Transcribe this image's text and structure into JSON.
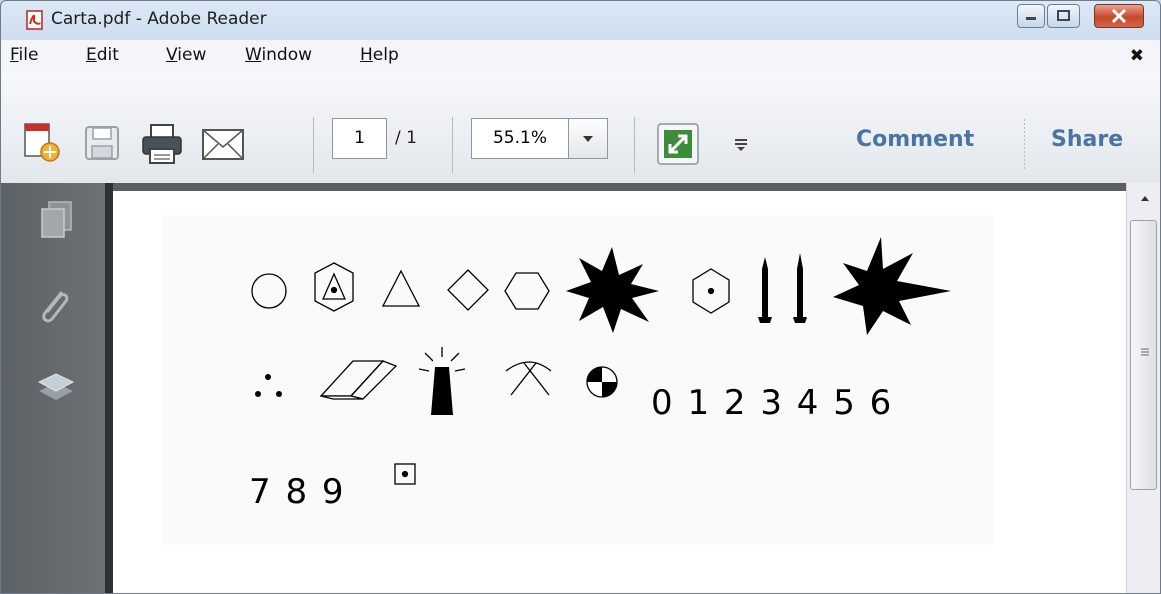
{
  "window": {
    "title": "Carta.pdf - Adobe Reader",
    "close_menu_glyph": "✖"
  },
  "menu": {
    "items": [
      "File",
      "Edit",
      "View",
      "Window",
      "Help"
    ]
  },
  "toolbar": {
    "page_current": "1",
    "page_total": "/ 1",
    "zoom": "55.1%",
    "comment_label": "Comment",
    "share_label": "Share"
  },
  "document": {
    "digits_line1": "0 1 2 3 4 5 6",
    "digits_line2": "7 8 9"
  },
  "colors": {
    "title_bg": "#c9d9ec",
    "link": "#4a75a2",
    "close_red": "#c44a2b",
    "pane": "#63686c"
  },
  "icons": [
    "pdf-app-icon",
    "minimize-icon",
    "maximize-icon",
    "close-icon",
    "create-pdf-icon",
    "save-icon",
    "print-icon",
    "email-icon",
    "dropdown-arrow-icon",
    "fullscreen-icon",
    "toolbar-options-icon",
    "pages-icon",
    "attachments-icon",
    "layers-icon"
  ]
}
